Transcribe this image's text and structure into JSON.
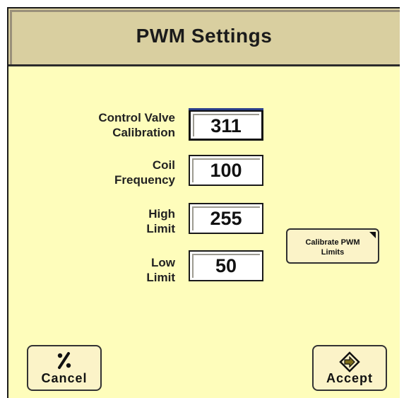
{
  "window": {
    "title": "PWM Settings"
  },
  "fields": [
    {
      "label_line1": "Control Valve",
      "label_line2": "Calibration",
      "value": "311"
    },
    {
      "label_line1": "Coil",
      "label_line2": "Frequency",
      "value": "100"
    },
    {
      "label_line1": "High",
      "label_line2": "Limit",
      "value": "255"
    },
    {
      "label_line1": "Low",
      "label_line2": "Limit",
      "value": "50"
    }
  ],
  "calibrate_button": {
    "line1": "Calibrate PWM",
    "line2": "Limits"
  },
  "cancel_button": {
    "label": "Cancel",
    "icon": "cancel-slash-icon"
  },
  "accept_button": {
    "label": "Accept",
    "icon": "accept-arrow-icon"
  },
  "colors": {
    "background": "#fefdbb",
    "title_bar": "#d9cfa0",
    "focus_accent": "#2a3e8a"
  }
}
